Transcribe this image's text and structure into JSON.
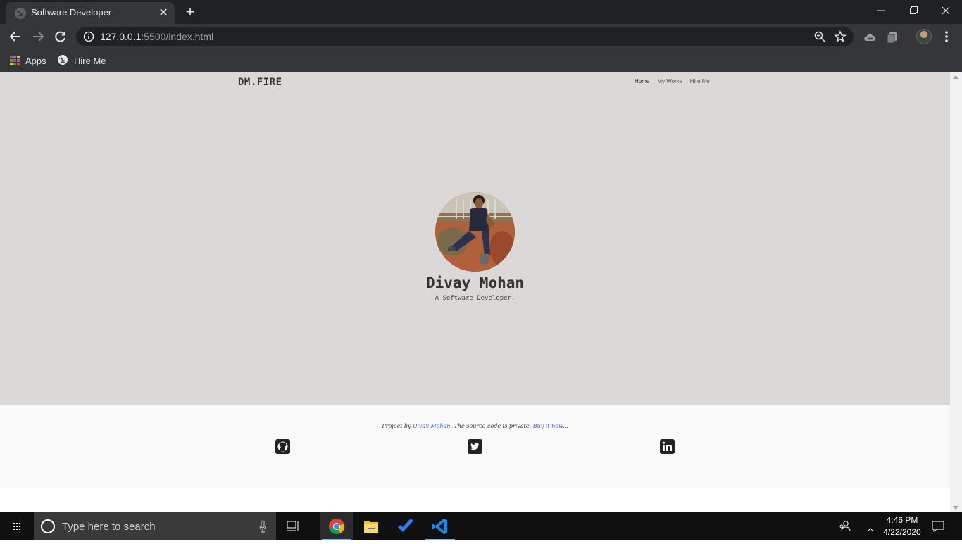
{
  "browser": {
    "tab_title": "Software Developer",
    "url_host": "127.0.0.1",
    "url_path": ":5500/index.html",
    "bookmarks": [
      {
        "label": "Apps",
        "icon": "apps-grid-icon"
      },
      {
        "label": "Hire Me",
        "icon": "globe-icon"
      }
    ]
  },
  "site": {
    "brand": "DM.FIRE",
    "nav": [
      "Home",
      "My Works",
      "Hire Me"
    ],
    "active_nav": "Home",
    "hero_name": "Divay Mohan",
    "hero_subtitle": "A Software Developer.",
    "footer": {
      "prefix": "Project by ",
      "author": "Divay Mohan",
      "middle": ". The source code is private. ",
      "cta": "Buy it now",
      "suffix": "..."
    },
    "social": [
      "github-icon",
      "twitter-icon",
      "linkedin-icon"
    ]
  },
  "taskbar": {
    "search_placeholder": "Type here to search",
    "time": "4:46 PM",
    "date": "4/22/2020",
    "pinned": [
      "task-view-icon",
      "chrome-icon",
      "file-explorer-icon",
      "todo-icon",
      "vscode-icon"
    ]
  },
  "colors": {
    "hero_bg": "#dcd8d7",
    "footer_bg": "#f9f9f9",
    "link": "#3a5fc8",
    "chrome_dark": "#202124",
    "chrome_toolbar": "#35363a"
  }
}
